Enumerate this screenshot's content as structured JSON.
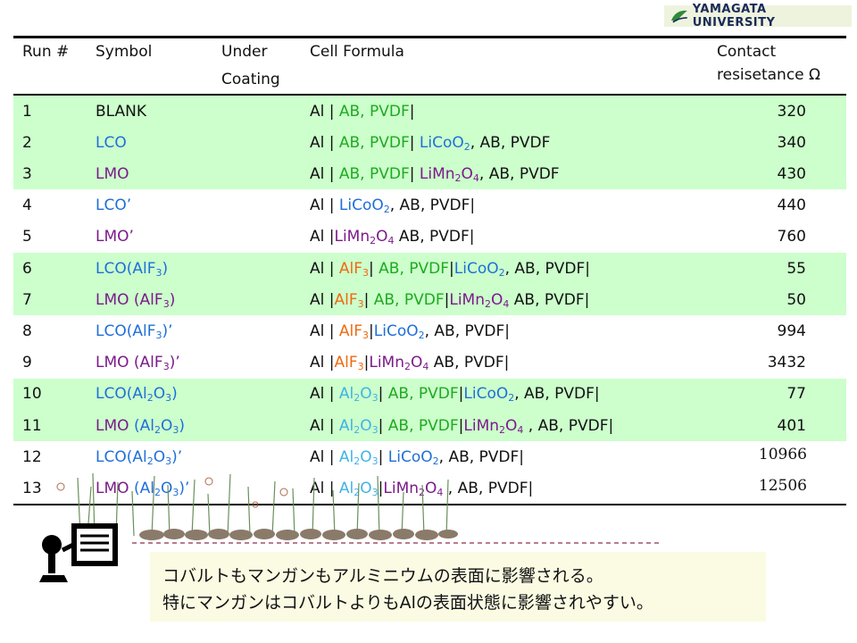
{
  "logo": {
    "text": "YAMAGATA UNIVERSITY"
  },
  "headers": {
    "run": "Run #",
    "symbol": "Symbol",
    "under1": "Under",
    "under2": "Coating",
    "formula": "Cell Formula",
    "res1": "Contact",
    "res2": "resisetance Ω"
  },
  "rows": [
    {
      "run": "1",
      "symbol": [
        [
          "BLANK",
          "k"
        ]
      ],
      "formula": [
        [
          "Al | ",
          "k"
        ],
        [
          "AB, PVDF",
          "g"
        ],
        [
          "|",
          "k"
        ]
      ],
      "res": "320",
      "band": true
    },
    {
      "run": "2",
      "symbol": [
        [
          "LCO",
          "b"
        ]
      ],
      "formula": [
        [
          "Al | ",
          "k"
        ],
        [
          "AB, PVDF",
          "g"
        ],
        [
          "| ",
          "k"
        ],
        [
          "LiCoO",
          "b"
        ],
        [
          "2",
          "b",
          "sub"
        ],
        [
          ", AB, PVDF",
          "k"
        ]
      ],
      "res": "340",
      "band": true
    },
    {
      "run": "3",
      "symbol": [
        [
          "LMO",
          "p"
        ]
      ],
      "formula": [
        [
          "Al | ",
          "k"
        ],
        [
          "AB, PVDF",
          "g"
        ],
        [
          "| ",
          "k"
        ],
        [
          "LiMn",
          "p"
        ],
        [
          "2",
          "p",
          "sub"
        ],
        [
          "O",
          "p"
        ],
        [
          "4",
          "p",
          "sub"
        ],
        [
          ", AB, PVDF",
          "k"
        ]
      ],
      "res": "430",
      "band": true
    },
    {
      "run": "4",
      "symbol": [
        [
          "LCO’",
          "b"
        ]
      ],
      "formula": [
        [
          "Al | ",
          "k"
        ],
        [
          "LiCoO",
          "b"
        ],
        [
          "2",
          "b",
          "sub"
        ],
        [
          ", AB, PVDF|",
          "k"
        ]
      ],
      "res": "440",
      "band": false
    },
    {
      "run": "5",
      "symbol": [
        [
          "LMO’",
          "p"
        ]
      ],
      "formula": [
        [
          "Al |",
          "k"
        ],
        [
          "LiMn",
          "p"
        ],
        [
          "2",
          "p",
          "sub"
        ],
        [
          "O",
          "p"
        ],
        [
          "4",
          "p",
          "sub"
        ],
        [
          " AB, PVDF|",
          "k"
        ]
      ],
      "res": "760",
      "band": false
    },
    {
      "run": "6",
      "symbol": [
        [
          "LCO(AlF",
          "b"
        ],
        [
          "3",
          "b",
          "sub"
        ],
        [
          ")",
          "b"
        ]
      ],
      "formula": [
        [
          "Al | ",
          "k"
        ],
        [
          "AlF",
          "o"
        ],
        [
          "3",
          "o",
          "sub"
        ],
        [
          "| ",
          "k"
        ],
        [
          "AB, PVDF",
          "g"
        ],
        [
          "|",
          "k"
        ],
        [
          "LiCoO",
          "b"
        ],
        [
          "2",
          "b",
          "sub"
        ],
        [
          ", AB, PVDF|",
          "k"
        ]
      ],
      "res": "55",
      "band": true
    },
    {
      "run": "7",
      "symbol": [
        [
          "LMO (AlF",
          "p"
        ],
        [
          "3",
          "p",
          "sub"
        ],
        [
          ")",
          "p"
        ]
      ],
      "formula": [
        [
          "Al |",
          "k"
        ],
        [
          "AlF",
          "o"
        ],
        [
          "3",
          "o",
          "sub"
        ],
        [
          "| ",
          "k"
        ],
        [
          "AB, PVDF",
          "g"
        ],
        [
          "|",
          "k"
        ],
        [
          "LiMn",
          "p"
        ],
        [
          "2",
          "p",
          "sub"
        ],
        [
          "O",
          "p"
        ],
        [
          "4",
          "p",
          "sub"
        ],
        [
          " AB, PVDF|",
          "k"
        ]
      ],
      "res": "50",
      "band": true
    },
    {
      "run": "8",
      "symbol": [
        [
          "LCO(AlF",
          "b"
        ],
        [
          "3",
          "b",
          "sub"
        ],
        [
          ")’",
          "b"
        ]
      ],
      "formula": [
        [
          "Al | ",
          "k"
        ],
        [
          "AlF",
          "o"
        ],
        [
          "3",
          "o",
          "sub"
        ],
        [
          "|",
          "k"
        ],
        [
          "LiCoO",
          "b"
        ],
        [
          "2",
          "b",
          "sub"
        ],
        [
          ", AB, PVDF|",
          "k"
        ]
      ],
      "res": "994",
      "band": false
    },
    {
      "run": "9",
      "symbol": [
        [
          "LMO (AlF",
          "p"
        ],
        [
          "3",
          "p",
          "sub"
        ],
        [
          ")’",
          "p"
        ]
      ],
      "formula": [
        [
          "Al |",
          "k"
        ],
        [
          "AlF",
          "o"
        ],
        [
          "3",
          "o",
          "sub"
        ],
        [
          "|",
          "k"
        ],
        [
          "LiMn",
          "p"
        ],
        [
          "2",
          "p",
          "sub"
        ],
        [
          "O",
          "p"
        ],
        [
          "4",
          "p",
          "sub"
        ],
        [
          " AB, PVDF|",
          "k"
        ]
      ],
      "res": "3432",
      "band": false
    },
    {
      "run": "10",
      "symbol": [
        [
          "LCO(Al",
          "b"
        ],
        [
          "2",
          "b",
          "sub"
        ],
        [
          "O",
          "b"
        ],
        [
          "3",
          "b",
          "sub"
        ],
        [
          ")",
          "b"
        ]
      ],
      "formula": [
        [
          "Al | ",
          "k"
        ],
        [
          "Al",
          "c"
        ],
        [
          "2",
          "c",
          "sub"
        ],
        [
          "O",
          "c"
        ],
        [
          "3",
          "c",
          "sub"
        ],
        [
          "| ",
          "k"
        ],
        [
          "AB, PVDF",
          "g"
        ],
        [
          "|",
          "k"
        ],
        [
          "LiCoO",
          "b"
        ],
        [
          "2",
          "b",
          "sub"
        ],
        [
          ", AB, PVDF|",
          "k"
        ]
      ],
      "res": "77",
      "band": true
    },
    {
      "run": "11",
      "symbol": [
        [
          "LMO ",
          "p"
        ],
        [
          "(Al",
          "b"
        ],
        [
          "2",
          "b",
          "sub"
        ],
        [
          "O",
          "b"
        ],
        [
          "3",
          "b",
          "sub"
        ],
        [
          ")",
          "b"
        ]
      ],
      "formula": [
        [
          "Al | ",
          "k"
        ],
        [
          "Al",
          "c"
        ],
        [
          "2",
          "c",
          "sub"
        ],
        [
          "O",
          "c"
        ],
        [
          "3",
          "c",
          "sub"
        ],
        [
          "| ",
          "k"
        ],
        [
          "AB, PVDF",
          "g"
        ],
        [
          "|",
          "k"
        ],
        [
          "LiMn",
          "p"
        ],
        [
          "2",
          "p",
          "sub"
        ],
        [
          "O",
          "p"
        ],
        [
          "4",
          "p",
          "sub"
        ],
        [
          " , AB, PVDF|",
          "k"
        ]
      ],
      "res": "401",
      "band": true
    },
    {
      "run": "12",
      "symbol": [
        [
          "LCO(Al",
          "b"
        ],
        [
          "2",
          "b",
          "sub"
        ],
        [
          "O",
          "b"
        ],
        [
          "3",
          "b",
          "sub"
        ],
        [
          ")’",
          "b"
        ]
      ],
      "formula": [
        [
          "Al | ",
          "k"
        ],
        [
          "Al",
          "c"
        ],
        [
          "2",
          "c",
          "sub"
        ],
        [
          "O",
          "c"
        ],
        [
          "3",
          "c",
          "sub"
        ],
        [
          "| ",
          "k"
        ],
        [
          "LiCoO",
          "b"
        ],
        [
          "2",
          "b",
          "sub"
        ],
        [
          ", AB, PVDF|",
          "k"
        ]
      ],
      "res": "10966",
      "band": false,
      "serif": true
    },
    {
      "run": "13",
      "symbol": [
        [
          "LMO ",
          "p"
        ],
        [
          "(Al",
          "b"
        ],
        [
          "2",
          "b",
          "sub"
        ],
        [
          "O",
          "b"
        ],
        [
          "3",
          "b",
          "sub"
        ],
        [
          ")’",
          "b"
        ]
      ],
      "formula": [
        [
          "Al | ",
          "k"
        ],
        [
          "Al",
          "c"
        ],
        [
          "2",
          "c",
          "sub"
        ],
        [
          "O",
          "c"
        ],
        [
          "3",
          "c",
          "sub"
        ],
        [
          "|",
          "k"
        ],
        [
          "LiMn",
          "p"
        ],
        [
          "2",
          "p",
          "sub"
        ],
        [
          "O",
          "p"
        ],
        [
          "4",
          "p",
          "sub"
        ],
        [
          " , AB, PVDF|",
          "k"
        ]
      ],
      "res": "12506",
      "band": false,
      "serif": true
    }
  ],
  "note": {
    "line1": "コバルトもマンガンもアルミニウムの表面に影響される。",
    "line2": "特にマンガンはコバルトよりもAlの表面状態に影響されやすい。"
  },
  "colors": {
    "band": "#ccffcc",
    "green": "#1faa1f",
    "blue": "#1e6fd9",
    "purple": "#7b1a8a",
    "orange": "#ee6a10",
    "cyan": "#3fb2e8"
  }
}
